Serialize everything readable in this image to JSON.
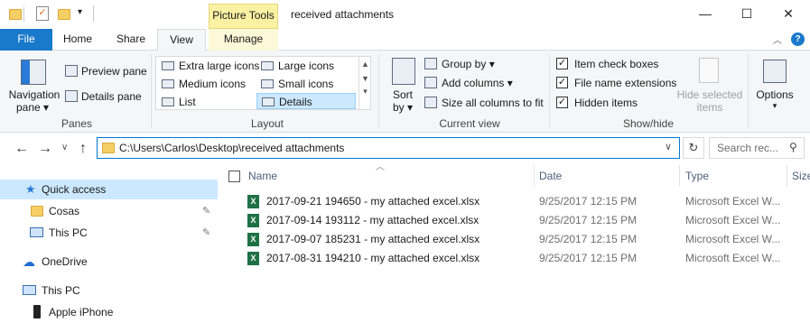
{
  "window": {
    "context_tab": "Picture Tools",
    "title": "received attachments",
    "minimize": "—",
    "maximize": "☐",
    "close": "✕"
  },
  "tabs": [
    "File",
    "Home",
    "Share",
    "View",
    "Manage"
  ],
  "ribbon": {
    "panes": {
      "navigation_pane": [
        "Navigation",
        "pane"
      ],
      "preview_pane": "Preview pane",
      "details_pane": "Details pane",
      "label": "Panes"
    },
    "layout": {
      "items": [
        "Extra large icons",
        "Large icons",
        "Medium icons",
        "Small icons",
        "List",
        "Details"
      ],
      "selected": "Details",
      "label": "Layout"
    },
    "current_view": {
      "sort_by": [
        "Sort",
        "by"
      ],
      "group_by": "Group by",
      "add_columns": "Add columns",
      "size_all": "Size all columns to fit",
      "label": "Current view"
    },
    "show_hide": {
      "item_check_boxes": "Item check boxes",
      "file_name_extensions": "File name extensions",
      "hidden_items": "Hidden items",
      "hide_selected": [
        "Hide selected",
        "items"
      ],
      "label": "Show/hide",
      "checked": [
        true,
        true,
        true
      ]
    },
    "options": "Options"
  },
  "address": {
    "path": "C:\\Users\\Carlos\\Desktop\\received attachments",
    "search_placeholder": "Search rec..."
  },
  "nav": [
    {
      "label": "Quick access",
      "icon": "star-icon",
      "indent": 0,
      "selected": true,
      "pinned": false
    },
    {
      "label": "Cosas",
      "icon": "folder-icon",
      "indent": 1,
      "selected": false,
      "pinned": true
    },
    {
      "label": "This PC",
      "icon": "pc-icon",
      "indent": 1,
      "selected": false,
      "pinned": true
    },
    {
      "label": "OneDrive",
      "icon": "cloud-icon",
      "indent": 0,
      "selected": false,
      "pinned": false
    },
    {
      "label": "This PC",
      "icon": "pc-icon",
      "indent": 0,
      "selected": false,
      "pinned": false
    },
    {
      "label": "Apple iPhone",
      "icon": "phone-icon",
      "indent": 1,
      "selected": false,
      "pinned": false
    }
  ],
  "columns": [
    "Name",
    "Date",
    "Type",
    "Size"
  ],
  "files": [
    {
      "name": "2017-09-21 194650 - my attached excel.xlsx",
      "date": "9/25/2017 12:15 PM",
      "type": "Microsoft Excel W..."
    },
    {
      "name": "2017-09-14 193112 - my attached excel.xlsx",
      "date": "9/25/2017 12:15 PM",
      "type": "Microsoft Excel W..."
    },
    {
      "name": "2017-09-07 185231 - my attached excel.xlsx",
      "date": "9/25/2017 12:15 PM",
      "type": "Microsoft Excel W..."
    },
    {
      "name": "2017-08-31 194210 - my attached excel.xlsx",
      "date": "9/25/2017 12:15 PM",
      "type": "Microsoft Excel W..."
    }
  ],
  "colors": {
    "accent": "#1979ca",
    "selection": "#cce8ff",
    "context_tab": "#fbf1a3",
    "excel": "#1e7145"
  }
}
